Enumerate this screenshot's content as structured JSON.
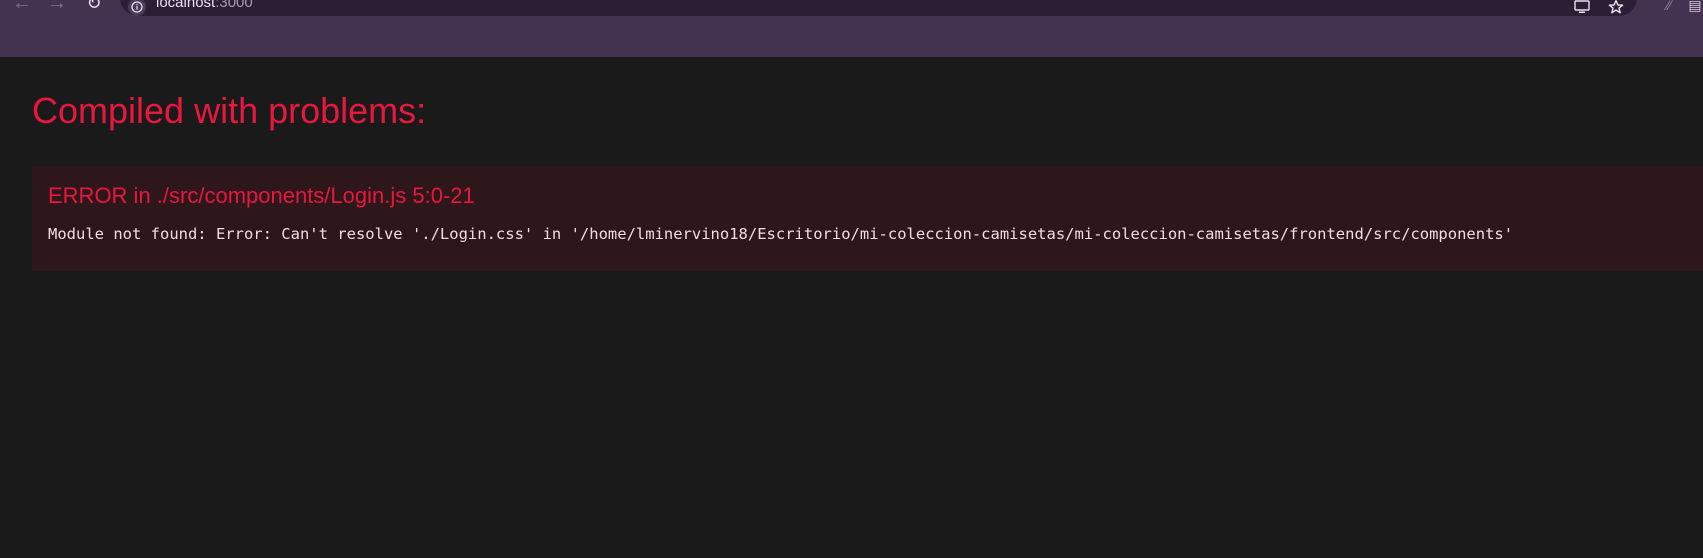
{
  "browser": {
    "url_host": "localhost",
    "url_port": ":3000",
    "icons": {
      "back": "arrow-left-icon",
      "forward": "arrow-right-icon",
      "reload": "reload-icon",
      "site_info": "info-icon",
      "cast": "cast-icon",
      "bookmark": "star-icon",
      "extensions": "puzzle-icon",
      "profile": "profile-icon"
    },
    "colors": {
      "chrome_bg": "#433350",
      "omnibox_bg": "#2b1f36"
    }
  },
  "overlay": {
    "title": "Compiled with problems:",
    "errors": [
      {
        "header": "ERROR in ./src/components/Login.js 5:0-21",
        "message": "Module not found: Error: Can't resolve './Login.css' in '/home/lminervino18/Escritorio/mi-coleccion-camisetas/mi-coleccion-camisetas/frontend/src/components'"
      }
    ],
    "colors": {
      "background": "#1a1a1a",
      "error_red": "#e8173f",
      "card_bg": "#2e171a",
      "message_text": "#f0dede"
    }
  }
}
